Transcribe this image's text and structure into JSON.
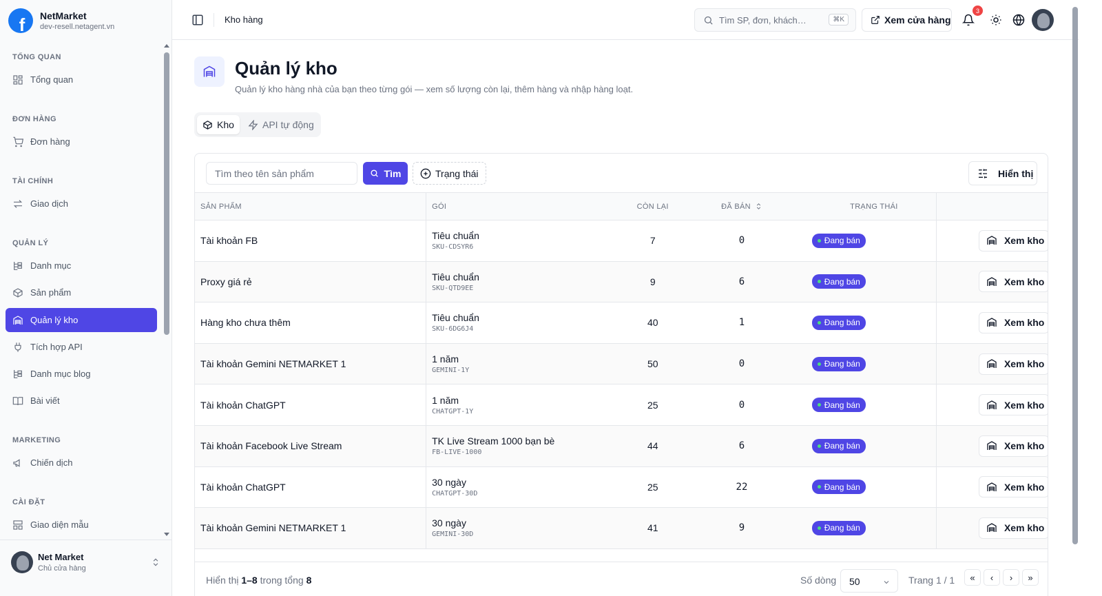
{
  "brand": {
    "name": "NetMarket",
    "domain": "dev-resell.netagent.vn",
    "logo_letter": "f"
  },
  "sidebar": {
    "sections": [
      {
        "title": "TỔNG QUAN",
        "items": [
          {
            "label": "Tổng quan",
            "icon": "dashboard-icon"
          }
        ]
      },
      {
        "title": "ĐƠN HÀNG",
        "items": [
          {
            "label": "Đơn hàng",
            "icon": "cart-icon"
          }
        ]
      },
      {
        "title": "TÀI CHÍNH",
        "items": [
          {
            "label": "Giao dịch",
            "icon": "transfer-icon"
          }
        ]
      },
      {
        "title": "QUẢN LÝ",
        "items": [
          {
            "label": "Danh mục",
            "icon": "tree-icon"
          },
          {
            "label": "Sản phẩm",
            "icon": "box-icon"
          },
          {
            "label": "Quản lý kho",
            "icon": "warehouse-icon",
            "active": true
          },
          {
            "label": "Tích hợp API",
            "icon": "plug-icon"
          },
          {
            "label": "Danh mục blog",
            "icon": "tree-icon"
          },
          {
            "label": "Bài viết",
            "icon": "book-icon"
          }
        ]
      },
      {
        "title": "MARKETING",
        "items": [
          {
            "label": "Chiến dịch",
            "icon": "megaphone-icon"
          }
        ]
      },
      {
        "title": "CÀI ĐẶT",
        "items": [
          {
            "label": "Giao diện mẫu",
            "icon": "layout-icon"
          }
        ]
      }
    ],
    "user": {
      "name": "Net Market",
      "role": "Chủ cửa hàng"
    }
  },
  "header": {
    "title": "Kho hàng",
    "search_placeholder": "Tìm SP, đơn, khách…",
    "search_shortcut": "⌘K",
    "store_button": "Xem cửa hàng",
    "notification_count": "3"
  },
  "page": {
    "title": "Quản lý kho",
    "subtitle": "Quản lý kho hàng nhà của bạn theo từng gói — xem số lượng còn lại, thêm hàng và nhập hàng loạt.",
    "tabs": [
      {
        "label": "Kho",
        "active": true
      },
      {
        "label": "API tự động",
        "active": false
      }
    ]
  },
  "filters": {
    "search_placeholder": "Tìm theo tên sản phẩm",
    "find_button": "Tìm",
    "status_button": "Trạng thái",
    "display_button": "Hiển thị"
  },
  "table": {
    "columns": {
      "product": "SẢN PHẨM",
      "package": "GÓI",
      "remaining": "CÒN LẠI",
      "sold": "ĐÃ BÁN",
      "status": "TRẠNG THÁI"
    },
    "action_label": "Xem kho",
    "rows": [
      {
        "product": "Tài khoản FB",
        "package": "Tiêu chuẩn",
        "sku": "SKU-CDSYR6",
        "remaining": "7",
        "sold": "0",
        "status": "Đang bán"
      },
      {
        "product": "Proxy giá rẻ",
        "package": "Tiêu chuẩn",
        "sku": "SKU-QTD9EE",
        "remaining": "9",
        "sold": "6",
        "status": "Đang bán"
      },
      {
        "product": "Hàng kho chưa thêm",
        "package": "Tiêu chuẩn",
        "sku": "SKU-6DG6J4",
        "remaining": "40",
        "sold": "1",
        "status": "Đang bán"
      },
      {
        "product": "Tài khoản Gemini NETMARKET 1",
        "package": "1 năm",
        "sku": "GEMINI-1Y",
        "remaining": "50",
        "sold": "0",
        "status": "Đang bán"
      },
      {
        "product": "Tài khoản ChatGPT",
        "package": "1 năm",
        "sku": "CHATGPT-1Y",
        "remaining": "25",
        "sold": "0",
        "status": "Đang bán"
      },
      {
        "product": "Tài khoản Facebook Live Stream",
        "package": "TK Live Stream 1000 bạn bè",
        "sku": "FB-LIVE-1000",
        "remaining": "44",
        "sold": "6",
        "status": "Đang bán"
      },
      {
        "product": "Tài khoản ChatGPT",
        "package": "30 ngày",
        "sku": "CHATGPT-30D",
        "remaining": "25",
        "sold": "22",
        "status": "Đang bán"
      },
      {
        "product": "Tài khoản Gemini NETMARKET 1",
        "package": "30 ngày",
        "sku": "GEMINI-30D",
        "remaining": "41",
        "sold": "9",
        "status": "Đang bán"
      }
    ]
  },
  "pagination": {
    "showing_prefix": "Hiển thị",
    "showing_range": "1–8",
    "showing_middle": "trong tổng",
    "total": "8",
    "rows_label": "Số dòng",
    "rows_value": "50",
    "page_label": "Trang 1 / 1"
  },
  "colors": {
    "accent": "#4f46e5",
    "status_dot": "#4ade80",
    "notification": "#ef4444",
    "brand_blue": "#1877f2"
  }
}
